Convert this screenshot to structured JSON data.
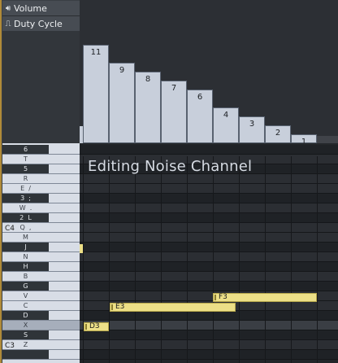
{
  "sidebar": {
    "volume_label": "Volume",
    "duty_label": "Duty Cycle"
  },
  "piano": {
    "keys": [
      {
        "label": "6",
        "black": true
      },
      {
        "label": "T",
        "black": false
      },
      {
        "label": "5",
        "black": true
      },
      {
        "label": "R",
        "black": false
      },
      {
        "label": "E  /",
        "black": false
      },
      {
        "label": "3  ;",
        "black": true
      },
      {
        "label": "W  .",
        "black": false
      },
      {
        "label": "2  L",
        "black": true
      },
      {
        "label": "Q  ,",
        "black": false
      },
      {
        "label": "M",
        "black": false
      },
      {
        "label": "J",
        "black": true
      },
      {
        "label": "N",
        "black": false
      },
      {
        "label": "H",
        "black": true
      },
      {
        "label": "B",
        "black": false
      },
      {
        "label": "G",
        "black": true
      },
      {
        "label": "V",
        "black": false
      },
      {
        "label": "C",
        "black": false
      },
      {
        "label": "D",
        "black": true
      },
      {
        "label": "X",
        "black": false
      },
      {
        "label": "S",
        "black": true
      },
      {
        "label": "Z",
        "black": false
      },
      {
        "label": "",
        "black": true
      }
    ],
    "octave_c4": "C4",
    "octave_c3": "C3"
  },
  "volume": {
    "values": [
      11,
      9,
      8,
      7,
      6,
      4,
      3,
      2,
      1
    ]
  },
  "overlay": {
    "title": "Editing Noise Channel"
  },
  "notes": [
    {
      "label": "F3"
    },
    {
      "label": "E3"
    },
    {
      "label": "D3"
    }
  ]
}
